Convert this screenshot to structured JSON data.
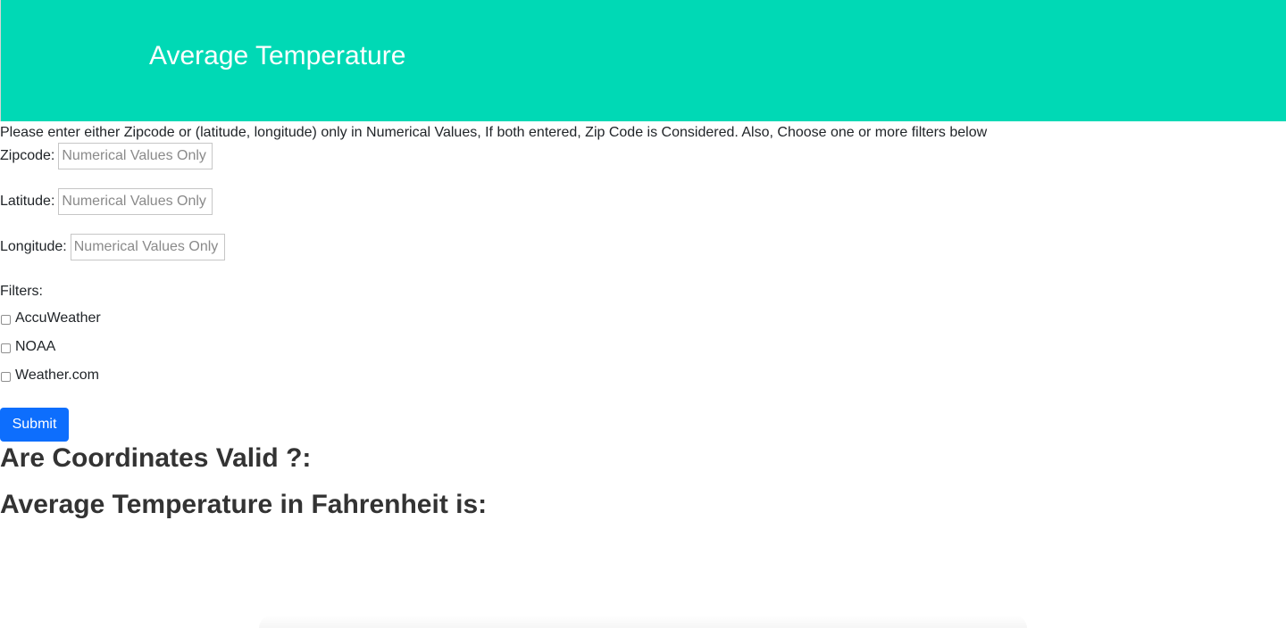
{
  "header": {
    "title": "Average Temperature",
    "background": "#00d9b5"
  },
  "form": {
    "instructions": "Please enter either Zipcode or (latitude, longitude) only in Numerical Values, If both entered, Zip Code is Considered. Also, Choose one or more filters below",
    "zipcode": {
      "label": "Zipcode:",
      "placeholder": "Numerical Values Only",
      "value": ""
    },
    "latitude": {
      "label": "Latitude:",
      "placeholder": "Numerical Values Only",
      "value": ""
    },
    "longitude": {
      "label": "Longitude:",
      "placeholder": "Numerical Values Only",
      "value": ""
    },
    "filters_label": "Filters:",
    "filters": [
      {
        "label": "AccuWeather",
        "checked": false
      },
      {
        "label": "NOAA",
        "checked": false
      },
      {
        "label": "Weather.com",
        "checked": false
      }
    ],
    "submit_label": "Submit",
    "submit_color": "#0d6efd"
  },
  "results": {
    "coordinates_valid_label": "Are Coordinates Valid ?:",
    "average_temp_label": "Average Temperature in Fahrenheit is:"
  }
}
